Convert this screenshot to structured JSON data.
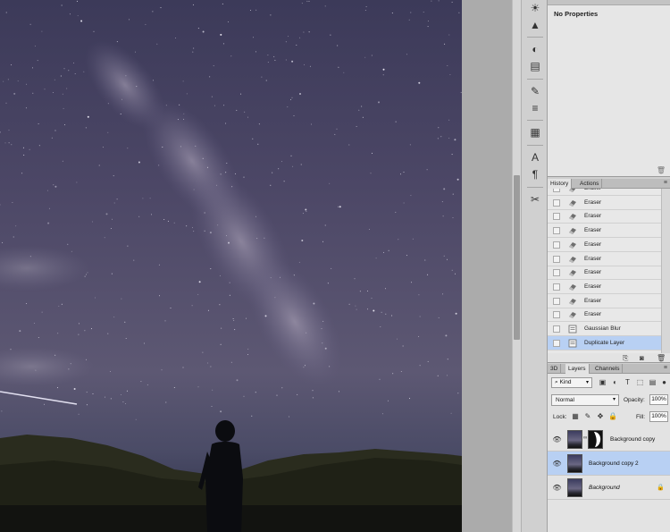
{
  "properties": {
    "title": "No Properties"
  },
  "history": {
    "tabs": [
      {
        "label": "History",
        "active": true
      },
      {
        "label": "Actions",
        "active": false
      }
    ],
    "items": [
      {
        "label": "Eraser",
        "icon": "eraser-icon",
        "selected": false
      },
      {
        "label": "Eraser",
        "icon": "eraser-icon",
        "selected": false
      },
      {
        "label": "Eraser",
        "icon": "eraser-icon",
        "selected": false
      },
      {
        "label": "Eraser",
        "icon": "eraser-icon",
        "selected": false
      },
      {
        "label": "Eraser",
        "icon": "eraser-icon",
        "selected": false
      },
      {
        "label": "Eraser",
        "icon": "eraser-icon",
        "selected": false
      },
      {
        "label": "Eraser",
        "icon": "eraser-icon",
        "selected": false
      },
      {
        "label": "Eraser",
        "icon": "eraser-icon",
        "selected": false
      },
      {
        "label": "Eraser",
        "icon": "eraser-icon",
        "selected": false
      },
      {
        "label": "Eraser",
        "icon": "eraser-icon",
        "selected": false
      },
      {
        "label": "Gaussian Blur",
        "icon": "filter-doc-icon",
        "selected": false
      },
      {
        "label": "Duplicate Layer",
        "icon": "layer-doc-icon",
        "selected": true
      }
    ]
  },
  "layers": {
    "tabs": [
      {
        "label": "3D",
        "active": false
      },
      {
        "label": "Layers",
        "active": true
      },
      {
        "label": "Channels",
        "active": false
      }
    ],
    "kind_label": "Kind",
    "blend_mode": "Normal",
    "opacity_label": "Opacity:",
    "opacity_value": "100%",
    "lock_label": "Lock:",
    "fill_label": "Fill:",
    "fill_value": "100%",
    "items": [
      {
        "name": "Background copy",
        "has_mask": true,
        "selected": false,
        "italic": false,
        "locked": false
      },
      {
        "name": "Background copy 2",
        "has_mask": false,
        "selected": true,
        "italic": false,
        "locked": false
      },
      {
        "name": "Background",
        "has_mask": false,
        "selected": false,
        "italic": true,
        "locked": true
      }
    ]
  },
  "colors": {
    "selection": "#b8d0f3",
    "panel_bg": "#e3e3e3",
    "sky_top": "#454160"
  }
}
